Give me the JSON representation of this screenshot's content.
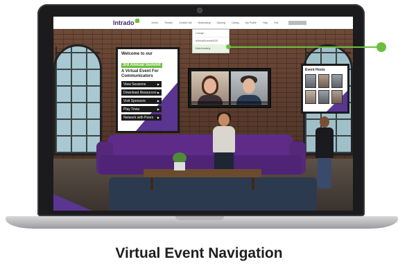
{
  "nav": {
    "logo": "Intrado",
    "items": [
      "Home",
      "Theater",
      "Exhibit Hall",
      "Networking",
      "Gaming",
      "Library",
      "My Profile",
      "Help",
      "Exit"
    ]
  },
  "dropdown": {
    "items": [
      "Lounge",
      "#VirtualSummit2020",
      "Matchmaking"
    ],
    "active_index": 2
  },
  "welcome": {
    "line1": "Welcome to our",
    "highlight": "3rd Annual Summit",
    "line2": "A Virtual Event For",
    "line3": "Communicators",
    "buttons": [
      "View Sessions",
      "Download Resources",
      "Visit Sponsors",
      "Play Trivia",
      "Network with Peers"
    ]
  },
  "hosts": {
    "title": "Event Hosts"
  },
  "caption": "Virtual Event Navigation",
  "colors": {
    "accent_green": "#6cbf3e",
    "brand_purple": "#5a3592",
    "panel_dark": "#1b1b1b"
  }
}
